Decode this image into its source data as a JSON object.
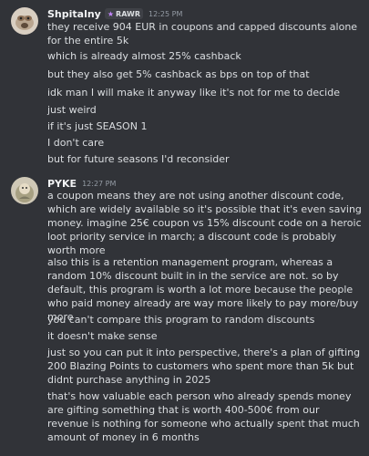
{
  "messages": [
    {
      "author": "Shpitalny",
      "badge": "RAWR",
      "badge_icon": "paw-badge-icon",
      "timestamp": "12:25 PM",
      "lines": [
        "they receive 904 EUR in coupons and capped discounts alone for the entire 5k",
        "which is already almost 25% cashback",
        "but they also get 5% cashback as bps on top of that",
        "idk man I will make it anyway like it's not for me to decide",
        "just weird",
        "if it's just SEASON 1",
        "I don't care",
        "but for future seasons I'd reconsider"
      ]
    },
    {
      "author": "PYKE",
      "timestamp": "12:27 PM",
      "lines": [
        "a coupon means they are not using another discount code, which are widely available so it's possible that it's even saving money. imagine 25€ coupon vs 15% discount code on a heroic loot priority service in march; a discount code is probably worth more",
        "also this is a retention management program, whereas a random 10% discount built in in the service are not. so by default, this program is worth a lot more because the people who paid money already are way more likely to pay more/buy more",
        "you can't compare this program to random discounts",
        "it doesn't make sense",
        "just so you can put it into perspective, there's a plan of gifting 200 Blazing Points to customers who spent more than 5k but didnt purchase anything in 2025",
        "that's how valuable each person who already spends money are gifting something that is worth 400-500€ from our revenue is nothing for someone who actually spent that much amount of money in 6 months"
      ]
    }
  ],
  "colors": {
    "background": "#313338",
    "text": "#dbdee1",
    "username": "#f2f3f5",
    "timestamp": "#949ba4",
    "badge_bg": "#3f4147",
    "badge_icon": "#c586ff"
  }
}
